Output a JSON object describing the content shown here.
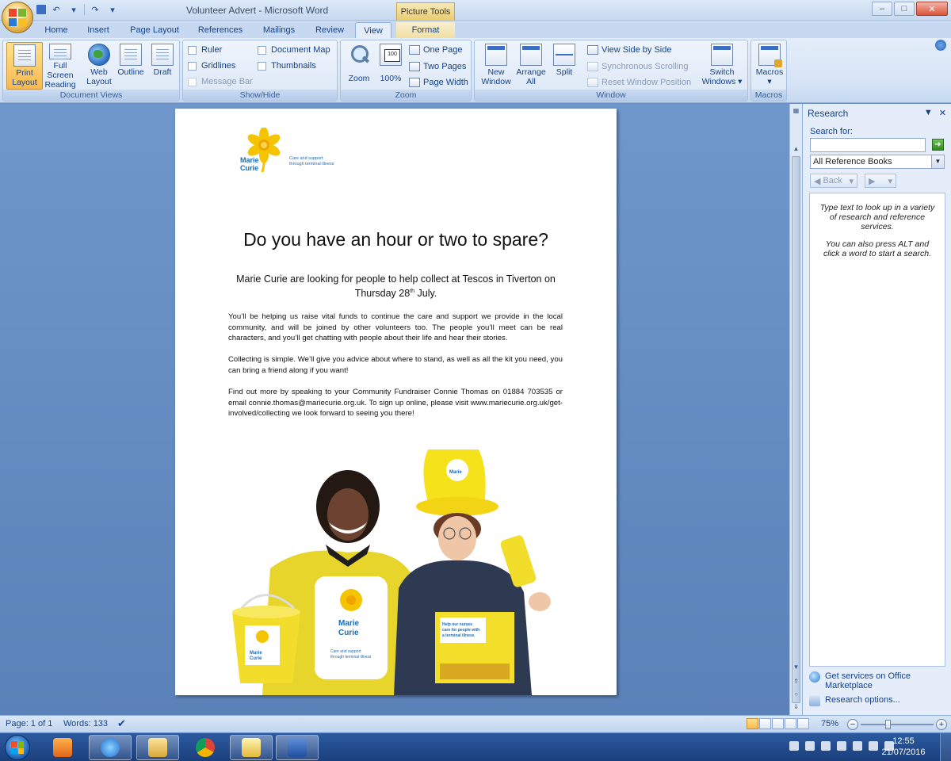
{
  "window": {
    "title": "Volunteer Advert - Microsoft Word",
    "context_tab": "Picture Tools",
    "controls": {
      "minimize": "–",
      "maximize": "□",
      "close": "✕"
    }
  },
  "quick_access": {
    "save": "💾",
    "undo": "↶",
    "redo": "↷"
  },
  "tabs": [
    {
      "label": "Home"
    },
    {
      "label": "Insert"
    },
    {
      "label": "Page Layout"
    },
    {
      "label": "References"
    },
    {
      "label": "Mailings"
    },
    {
      "label": "Review"
    },
    {
      "label": "View",
      "active": true
    },
    {
      "label": "Format"
    }
  ],
  "ribbon": {
    "document_views": {
      "label": "Document Views",
      "buttons": [
        "Print Layout",
        "Full Screen Reading",
        "Web Layout",
        "Outline",
        "Draft"
      ],
      "print_layout_l1": "Print",
      "print_layout_l2": "Layout",
      "fullscreen_l1": "Full Screen",
      "fullscreen_l2": "Reading",
      "web_l1": "Web",
      "web_l2": "Layout",
      "outline": "Outline",
      "draft": "Draft"
    },
    "show_hide": {
      "label": "Show/Hide",
      "ruler": "Ruler",
      "gridlines": "Gridlines",
      "message_bar": "Message Bar",
      "document_map": "Document Map",
      "thumbnails": "Thumbnails"
    },
    "zoom": {
      "label": "Zoom",
      "zoom": "Zoom",
      "hundred": "100%",
      "one_page": "One Page",
      "two_pages": "Two Pages",
      "page_width": "Page Width"
    },
    "window": {
      "label": "Window",
      "new_l1": "New",
      "new_l2": "Window",
      "arrange_l1": "Arrange",
      "arrange_l2": "All",
      "split": "Split",
      "side_by_side": "View Side by Side",
      "sync_scroll": "Synchronous Scrolling",
      "reset_pos": "Reset Window Position",
      "switch_l1": "Switch",
      "switch_l2": "Windows ▾"
    },
    "macros": {
      "label": "Macros",
      "button": "Macros"
    }
  },
  "document": {
    "logo_word": "Marie\nCurie",
    "logo_tagline": "Care and support\nthrough terminal illness",
    "headline": "Do you have an hour or two to spare?",
    "sub_line1": "Marie Curie are looking for people to help collect at Tescos in Tiverton on",
    "sub_line2_a": "Thursday 28",
    "sub_line2_sup": "th",
    "sub_line2_b": " July.",
    "para1": "You’ll be helping us raise vital funds to continue the care and support we provide in the local community, and will be joined by other volunteers too. The people you’ll meet can be real characters, and you’ll get chatting with people about their life and hear their stories.",
    "para2": "Collecting is simple. We’ll give you advice about where to stand, as well as all the kit you need, you can bring a friend along if you want!",
    "para3": "Find out more by speaking to your Community Fundraiser Connie Thomas on 01884 703535 or email connie.thomas@mariecurie.org.uk. To sign up online, please visit www.mariecurie.org.uk/get-involved/collecting we look forward to seeing you there!",
    "photo_text": {
      "hat_brand": "Marie\nCurie",
      "bucket_brand": "Marie\nCurie",
      "bib_brand": "Marie\nCurie",
      "bib_tagline": "Care and support\nthrough terminal illness",
      "box_header": "Help our nurses\ncare for people with\na terminal illness"
    }
  },
  "research": {
    "title": "Research",
    "search_for": "Search for:",
    "search_value": "",
    "source": "All Reference Books",
    "back": "Back",
    "hint1": "Type text to look up in a variety of research and reference services.",
    "hint2": "You can also press ALT and click a word to start a search.",
    "link1": "Get services on Office Marketplace",
    "link2": "Research options..."
  },
  "status": {
    "page": "Page: 1 of 1",
    "words": "Words: 133",
    "zoom": "75%",
    "zoom_level": 0.75
  },
  "taskbar": {
    "time": "12:55",
    "date": "21/07/2016"
  },
  "colors": {
    "daffodil": "#f5d20a",
    "brand_blue": "#1e6ab5",
    "ribbon_text": "#15428b"
  }
}
